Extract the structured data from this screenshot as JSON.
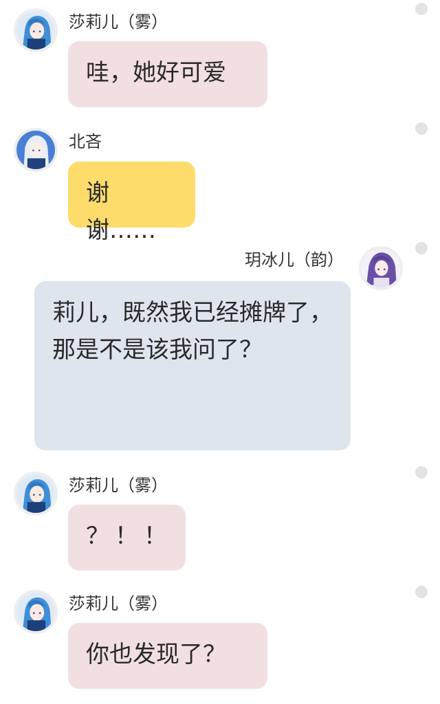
{
  "colors": {
    "bubble_pink": "#f2dfe2",
    "bubble_yellow": "#fddc6b",
    "bubble_blue": "#dee5ee",
    "status_dot": "#e3e3e3"
  },
  "messages": [
    {
      "sender": "莎莉儿（雾）",
      "text": "哇，她好可爱",
      "avatar": "blue-hair-girl-avatar"
    },
    {
      "sender": "北吝",
      "text": "谢谢……",
      "avatar": "white-hair-girl-avatar"
    },
    {
      "sender": "玥冰儿（韵）",
      "text": "莉儿，既然我已经摊牌了，那是不是该我问了？",
      "avatar": "purple-hair-girl-avatar"
    },
    {
      "sender": "莎莉儿（雾）",
      "text": "？！！",
      "avatar": "blue-hair-girl-avatar"
    },
    {
      "sender": "莎莉儿（雾）",
      "text": "你也发现了？",
      "avatar": "blue-hair-girl-avatar"
    }
  ]
}
